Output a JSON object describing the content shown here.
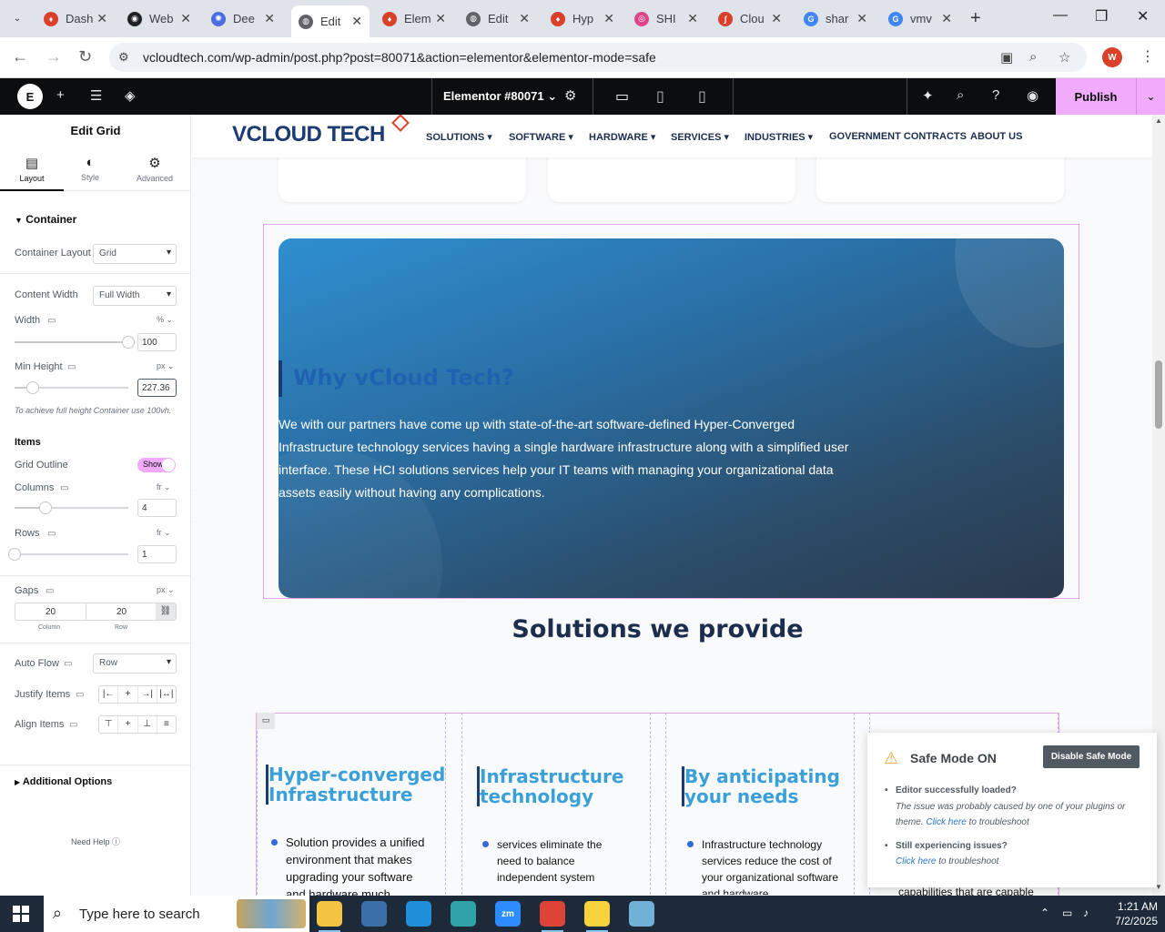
{
  "browser": {
    "tabs": [
      {
        "label": "Dash",
        "favicon_color": "#d9412a",
        "favicon_glyph": "♦"
      },
      {
        "label": "Web",
        "favicon_color": "#202124",
        "favicon_glyph": "◉"
      },
      {
        "label": "Dee",
        "favicon_color": "#4a6ee0",
        "favicon_glyph": "✺"
      },
      {
        "label": "Edit",
        "favicon_color": "#5f6368",
        "favicon_glyph": "◍"
      },
      {
        "label": "Elem",
        "favicon_color": "#d9412a",
        "favicon_glyph": "♦"
      },
      {
        "label": "Edit",
        "favicon_color": "#5f6368",
        "favicon_glyph": "◍"
      },
      {
        "label": "Hyp",
        "favicon_color": "#d9412a",
        "favicon_glyph": "♦"
      },
      {
        "label": "SHI",
        "favicon_color": "#e0458a",
        "favicon_glyph": "◎"
      },
      {
        "label": "Clou",
        "favicon_color": "#d9412a",
        "favicon_glyph": "∫"
      },
      {
        "label": "shar",
        "favicon_color": "#4285f4",
        "favicon_glyph": "G"
      },
      {
        "label": "vmv",
        "favicon_color": "#4285f4",
        "favicon_glyph": "G"
      }
    ],
    "active_tab_index": 3,
    "url": "vcloudtech.com/wp-admin/post.php?post=80071&action=elementor&elementor-mode=safe",
    "profile_initial": "W"
  },
  "editor": {
    "document_title": "Elementor #80071",
    "publish_label": "Publish"
  },
  "panel": {
    "title": "Edit Grid",
    "tabs": [
      {
        "label": "Layout",
        "icon": "layout-icon"
      },
      {
        "label": "Style",
        "icon": "half-circle-icon"
      },
      {
        "label": "Advanced",
        "icon": "gear-icon"
      }
    ],
    "container_section": "Container",
    "container_layout": {
      "label": "Container Layout",
      "value": "Grid"
    },
    "content_width": {
      "label": "Content Width",
      "value": "Full Width"
    },
    "width": {
      "label": "Width",
      "unit": "%",
      "value": "100",
      "slider_fraction": 1.0
    },
    "min_height": {
      "label": "Min Height",
      "unit": "px",
      "value": "227.36",
      "slider_fraction": 0.16
    },
    "min_height_hint": "To achieve full height Container use 100vh.",
    "items_heading": "Items",
    "grid_outline": {
      "label": "Grid Outline",
      "value": "Show"
    },
    "columns": {
      "label": "Columns",
      "unit": "fr",
      "value": "4",
      "slider_fraction": 0.27
    },
    "rows": {
      "label": "Rows",
      "unit": "fr",
      "value": "1",
      "slider_fraction": 0.0
    },
    "gaps": {
      "label": "Gaps",
      "unit": "px",
      "column": "20",
      "row": "20",
      "column_caption": "Column",
      "row_caption": "Row"
    },
    "auto_flow": {
      "label": "Auto Flow",
      "value": "Row"
    },
    "justify_items": {
      "label": "Justify Items"
    },
    "align_items": {
      "label": "Align Items"
    },
    "additional_options": "Additional Options",
    "need_help": "Need Help"
  },
  "site": {
    "brand": "VCLOUD TECH",
    "menu": [
      "SOLUTIONS",
      "SOFTWARE",
      "HARDWARE",
      "SERVICES",
      "INDUSTRIES",
      "GOVERNMENT CONTRACTS",
      "ABOUT US"
    ],
    "menu_has_dropdown": [
      true,
      true,
      true,
      true,
      true,
      false,
      false
    ],
    "hero_title": "Why vCloud Tech?",
    "hero_body": "We with our partners have come up with state-of-the-art software-defined Hyper-Converged Infrastructure technology services having a single hardware infrastructure along with a simplified user interface. These HCI solutions services help your IT teams with managing your organizational data assets easily without having any complications.",
    "solutions_title": "Solutions we provide",
    "solutions": [
      {
        "title_line1": "Hyper-converged",
        "title_line2": "Infrastructure",
        "text": "Solution provides a unified environment that makes upgrading your software and hardware much"
      },
      {
        "title_line1": "Infrastructure",
        "title_line2": "technology",
        "text": "services eliminate the need to balance independent system"
      },
      {
        "title_line1": "By anticipating",
        "title_line2": "your needs",
        "text": "Infrastructure technology services reduce the cost of your organizational software and hardware"
      },
      {
        "title_line1": "",
        "title_line2": "",
        "text": "capabilities that are capable"
      }
    ]
  },
  "safe_mode": {
    "title": "Safe Mode ON",
    "button": "Disable Safe Mode",
    "item1_heading": "Editor successfully loaded?",
    "item1_note": "The issue was probably caused by one of your plugins or theme.",
    "item1_link": "Click here",
    "item1_suffix": "to troubleshoot",
    "item2_heading": "Still experiencing issues?",
    "item2_link": "Click here",
    "item2_suffix": "to troubleshoot"
  },
  "taskbar": {
    "search_placeholder": "Type here to search",
    "time": "1:21 AM",
    "date": "7/2/2025",
    "apps": [
      {
        "name": "file-explorer",
        "color": "#f5c443"
      },
      {
        "name": "app-2",
        "color": "#3b6fa8"
      },
      {
        "name": "edge",
        "color": "#1e8fd9"
      },
      {
        "name": "app-4",
        "color": "#2fa3a8"
      },
      {
        "name": "zoom",
        "color": "#2d8cff"
      },
      {
        "name": "chrome",
        "color": "#db4437"
      },
      {
        "name": "sticky-notes",
        "color": "#f7d23c"
      },
      {
        "name": "app-8",
        "color": "#6fb2d6"
      }
    ],
    "zoom_label": "zm"
  }
}
